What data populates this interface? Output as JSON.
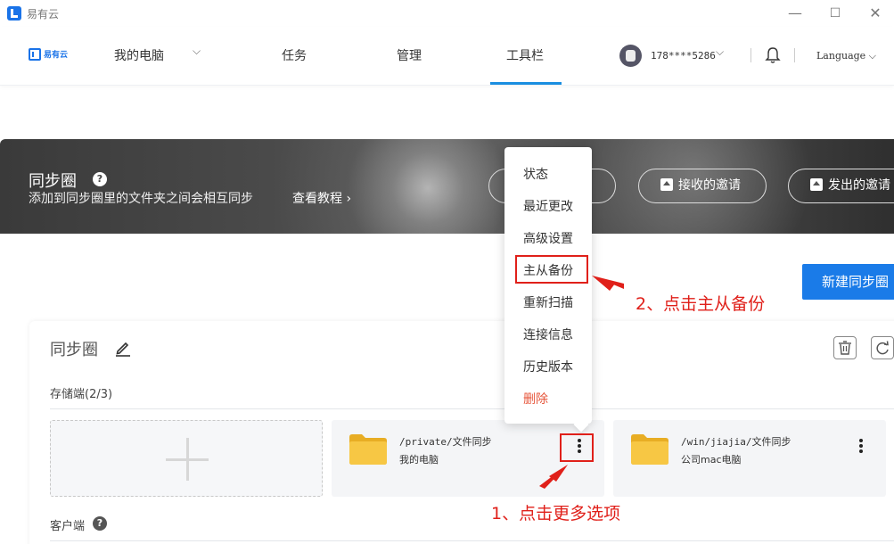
{
  "window": {
    "title": "易有云",
    "minimize": "—",
    "maximize": "☐",
    "close": "✕"
  },
  "nav": {
    "logo_text": "易有云",
    "my_computer": "我的电脑",
    "chevron": "⌵",
    "tasks": "任务",
    "manage": "管理",
    "toolbar": "工具栏",
    "phone": "178****5286",
    "user_chevron": "⌵",
    "language": "Language ⌵"
  },
  "banner": {
    "title": "同步圈",
    "help": "?",
    "subtitle": "添加到同步圈里的文件夹之间会相互同步",
    "tutorial_link": "查看教程 ›",
    "received_invites": "接收的邀请",
    "sent_invites": "发出的邀请"
  },
  "actions": {
    "new_sync_circle": "新建同步圈"
  },
  "card": {
    "title": "同步圈",
    "storage_label": "存储端(2/3)",
    "client_label": "客户端",
    "help": "?",
    "tiles": [
      {
        "path": "/private/文件同步",
        "name": "我的电脑"
      },
      {
        "path": "/win/jiajia/文件同步",
        "name": "公司mac电脑"
      }
    ]
  },
  "context_menu": {
    "items": [
      "状态",
      "最近更改",
      "高级设置",
      "主从备份",
      "重新扫描",
      "连接信息",
      "历史版本",
      "删除"
    ]
  },
  "annotations": {
    "step1": "1、点击更多选项",
    "step2": "2、点击主从备份"
  },
  "colors": {
    "accent": "#1a7be8",
    "annotation_red": "#e0201a",
    "folder_yellow": "#f7c744",
    "danger": "#e6553a"
  }
}
